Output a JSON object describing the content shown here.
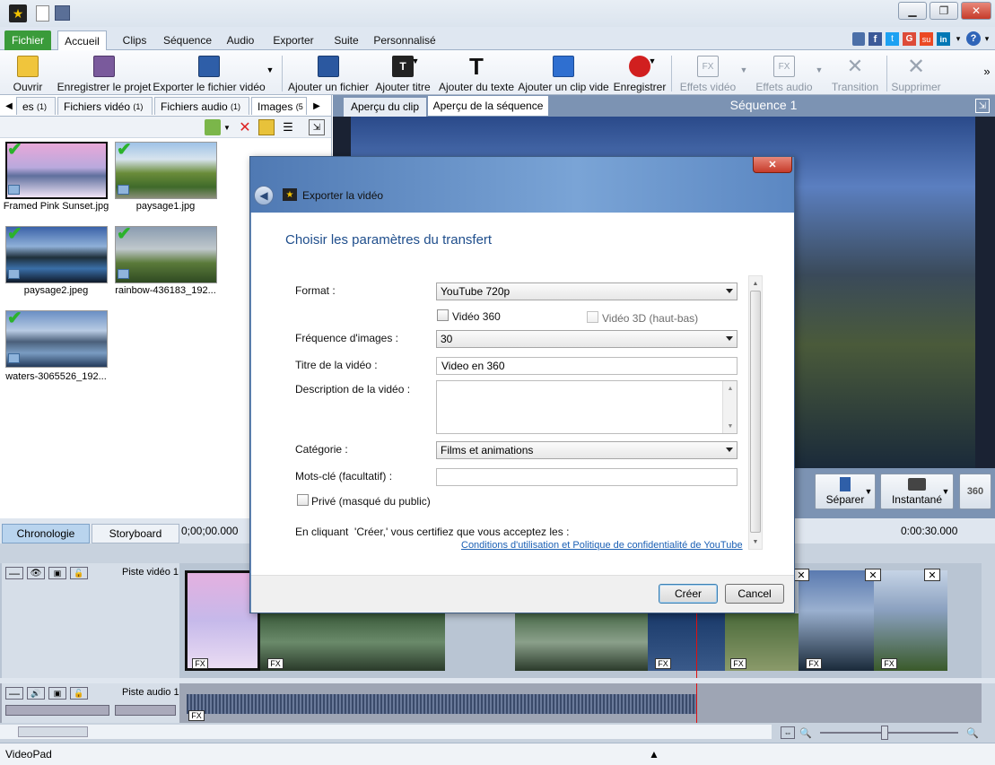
{
  "app": {
    "name": "VideoPad"
  },
  "ribbon_tabs": [
    "Fichier",
    "Accueil",
    "Clips",
    "Séquence",
    "Audio",
    "Exporter",
    "Suite",
    "Personnalisé"
  ],
  "ribbon_buttons": {
    "open": "Ouvrir",
    "save_project": "Enregistrer le projet",
    "export_video": "Exporter le fichier vidéo",
    "add_file": "Ajouter un fichier",
    "add_title": "Ajouter titre",
    "add_text": "Ajouter du texte",
    "add_clip": "Ajouter un clip vide",
    "record": "Enregistrer",
    "video_effects": "Effets vidéo",
    "audio_effects": "Effets audio",
    "transition": "Transition",
    "delete": "Supprimer"
  },
  "bin": {
    "tabs": [
      {
        "label": "es",
        "count": "(1)"
      },
      {
        "label": "Fichiers vidéo",
        "count": "(1)"
      },
      {
        "label": "Fichiers audio",
        "count": "(1)"
      },
      {
        "label": "Images",
        "count": "(5"
      }
    ],
    "items": [
      "Framed Pink Sunset.jpg",
      "paysage1.jpg",
      "paysage2.jpeg",
      "rainbow-436183_192...",
      "waters-3065526_192..."
    ]
  },
  "preview": {
    "tab_clip": "Aperçu du clip",
    "tab_sequence": "Aperçu de la séquence",
    "sequence_title": "Séquence 1",
    "split": "Séparer",
    "snapshot": "Instantané",
    "vr": "360"
  },
  "timeline": {
    "tab_timeline": "Chronologie",
    "tab_storyboard": "Storyboard",
    "time_start": "0;00;00.000",
    "time_end": "0:00:30.000",
    "video_track": "Piste vidéo 1",
    "audio_track": "Piste audio 1",
    "fx": "FX"
  },
  "dialog": {
    "title": "Exporter la vidéo",
    "heading": "Choisir les paramètres du transfert",
    "format_label": "Format :",
    "format_value": "YouTube 720p",
    "video360": "Vidéo 360",
    "video3d": "Vidéo 3D (haut-bas)",
    "fps_label": "Fréquence d'images :",
    "fps_value": "30",
    "title_label": "Titre de la vidéo :",
    "title_value": "Video en 360",
    "desc_label": "Description de la vidéo :",
    "category_label": "Catégorie :",
    "category_value": "Films et animations",
    "keywords_label": "Mots-clé (facultatif) :",
    "private_label": "Privé (masqué du public)",
    "terms_text": "En cliquant  'Créer,' vous certifiez que vous acceptez les :",
    "terms_link": "Conditions d'utilisation et Politique de confidentialité de YouTube",
    "create": "Créer",
    "cancel": "Cancel"
  },
  "colors": {
    "fichier_tab": "#3a9b3a",
    "active_tab": "#c2d9ef",
    "link": "#1a5fb4",
    "dialog_heading": "#1f4e8c"
  }
}
